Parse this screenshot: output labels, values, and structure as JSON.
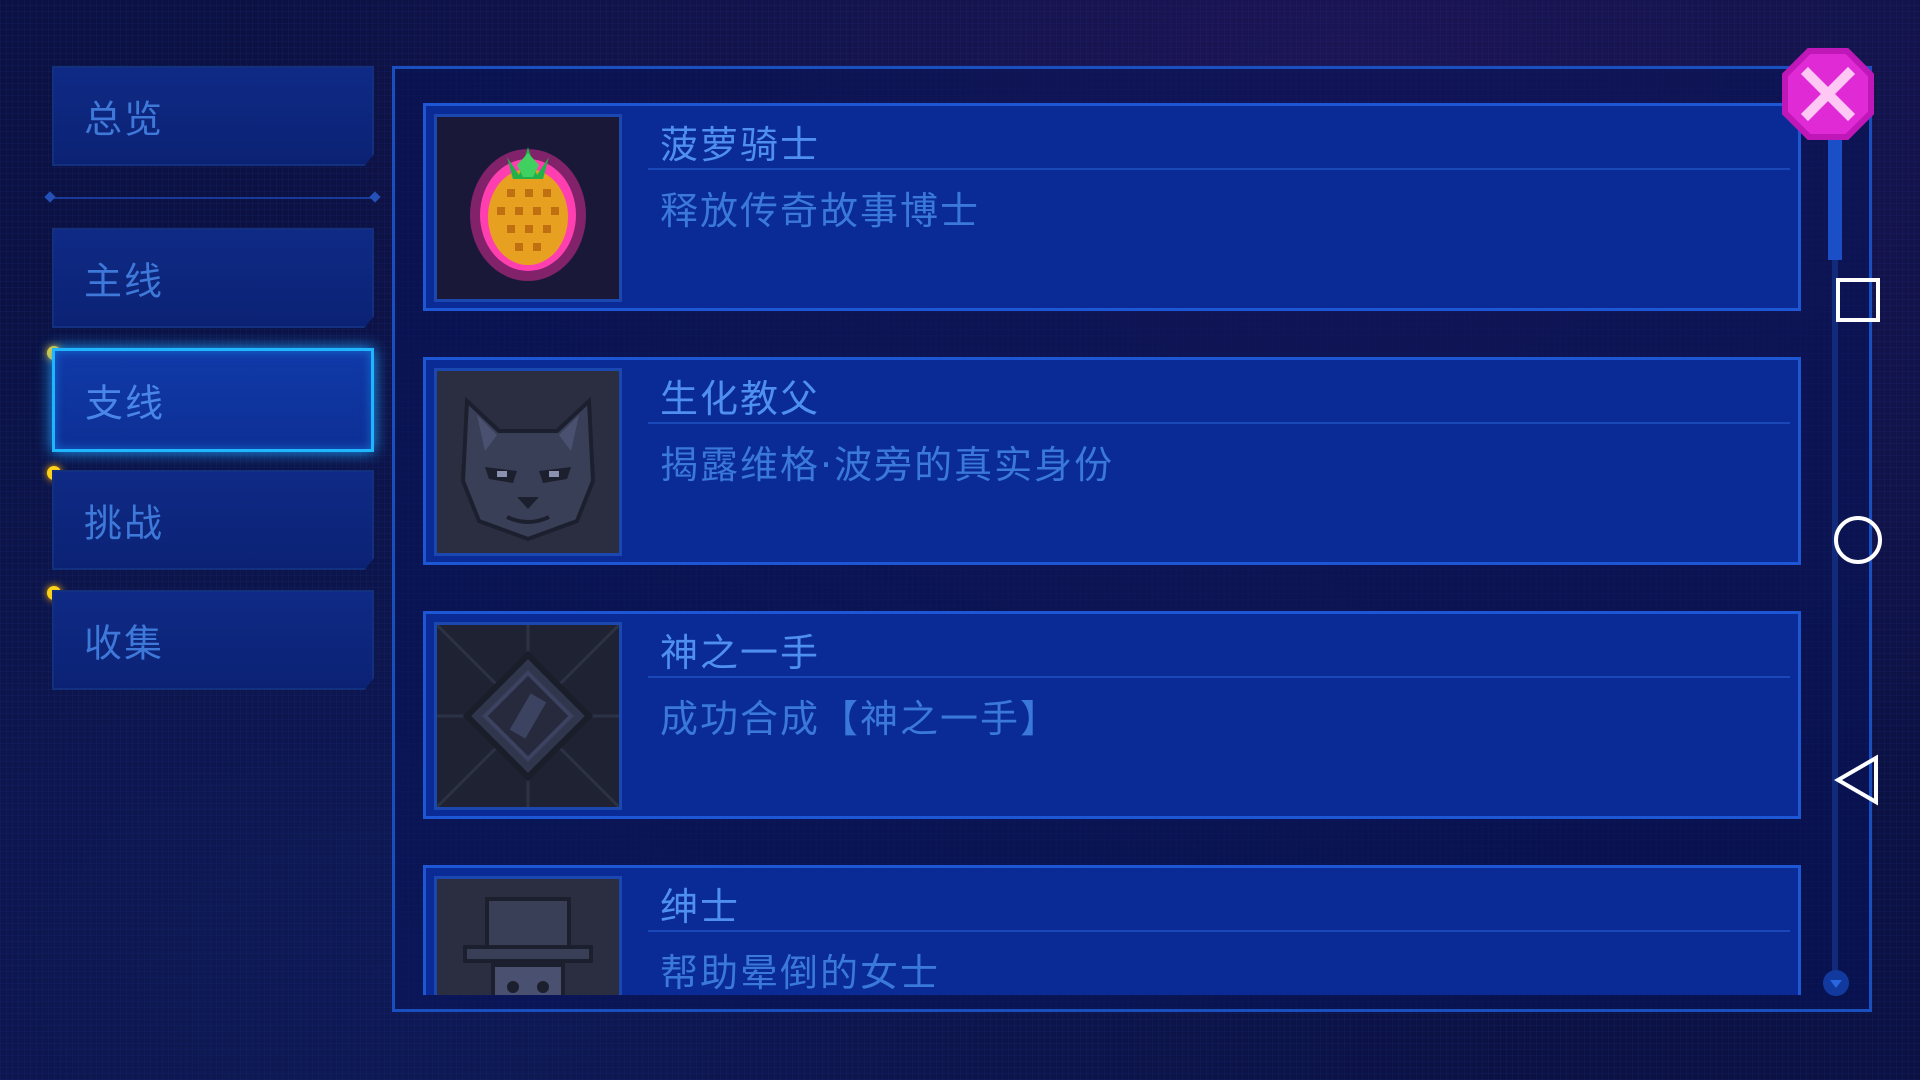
{
  "sidebar": {
    "items": [
      {
        "label": "总览",
        "active": false,
        "notify": false
      },
      {
        "label": "主线",
        "active": false,
        "notify": false
      },
      {
        "label": "支线",
        "active": true,
        "notify": true
      },
      {
        "label": "挑战",
        "active": false,
        "notify": true
      },
      {
        "label": "收集",
        "active": false,
        "notify": true
      }
    ],
    "notify_color": "#ffd21a",
    "active_border_color": "#1fb6ff"
  },
  "achievements": [
    {
      "title": "菠萝骑士",
      "description": "释放传奇故事博士",
      "icon": "pineapple-icon",
      "unlocked": true
    },
    {
      "title": "生化教父",
      "description": "揭露维格·波旁的真实身份",
      "icon": "cat-face-icon",
      "unlocked": false
    },
    {
      "title": "神之一手",
      "description": "成功合成【神之一手】",
      "icon": "diamond-emblem-icon",
      "unlocked": false
    },
    {
      "title": "绅士",
      "description": "帮助晕倒的女士",
      "icon": "gentleman-hat-icon",
      "unlocked": false
    }
  ],
  "close_button": {
    "icon": "close-icon",
    "color": "#e02ad6"
  },
  "system_nav": {
    "recents": "square-icon",
    "home": "circle-icon",
    "back": "triangle-back-icon"
  },
  "colors": {
    "background": "#0b1142",
    "card": "#0a2a95",
    "text": "#4f8ff0"
  }
}
